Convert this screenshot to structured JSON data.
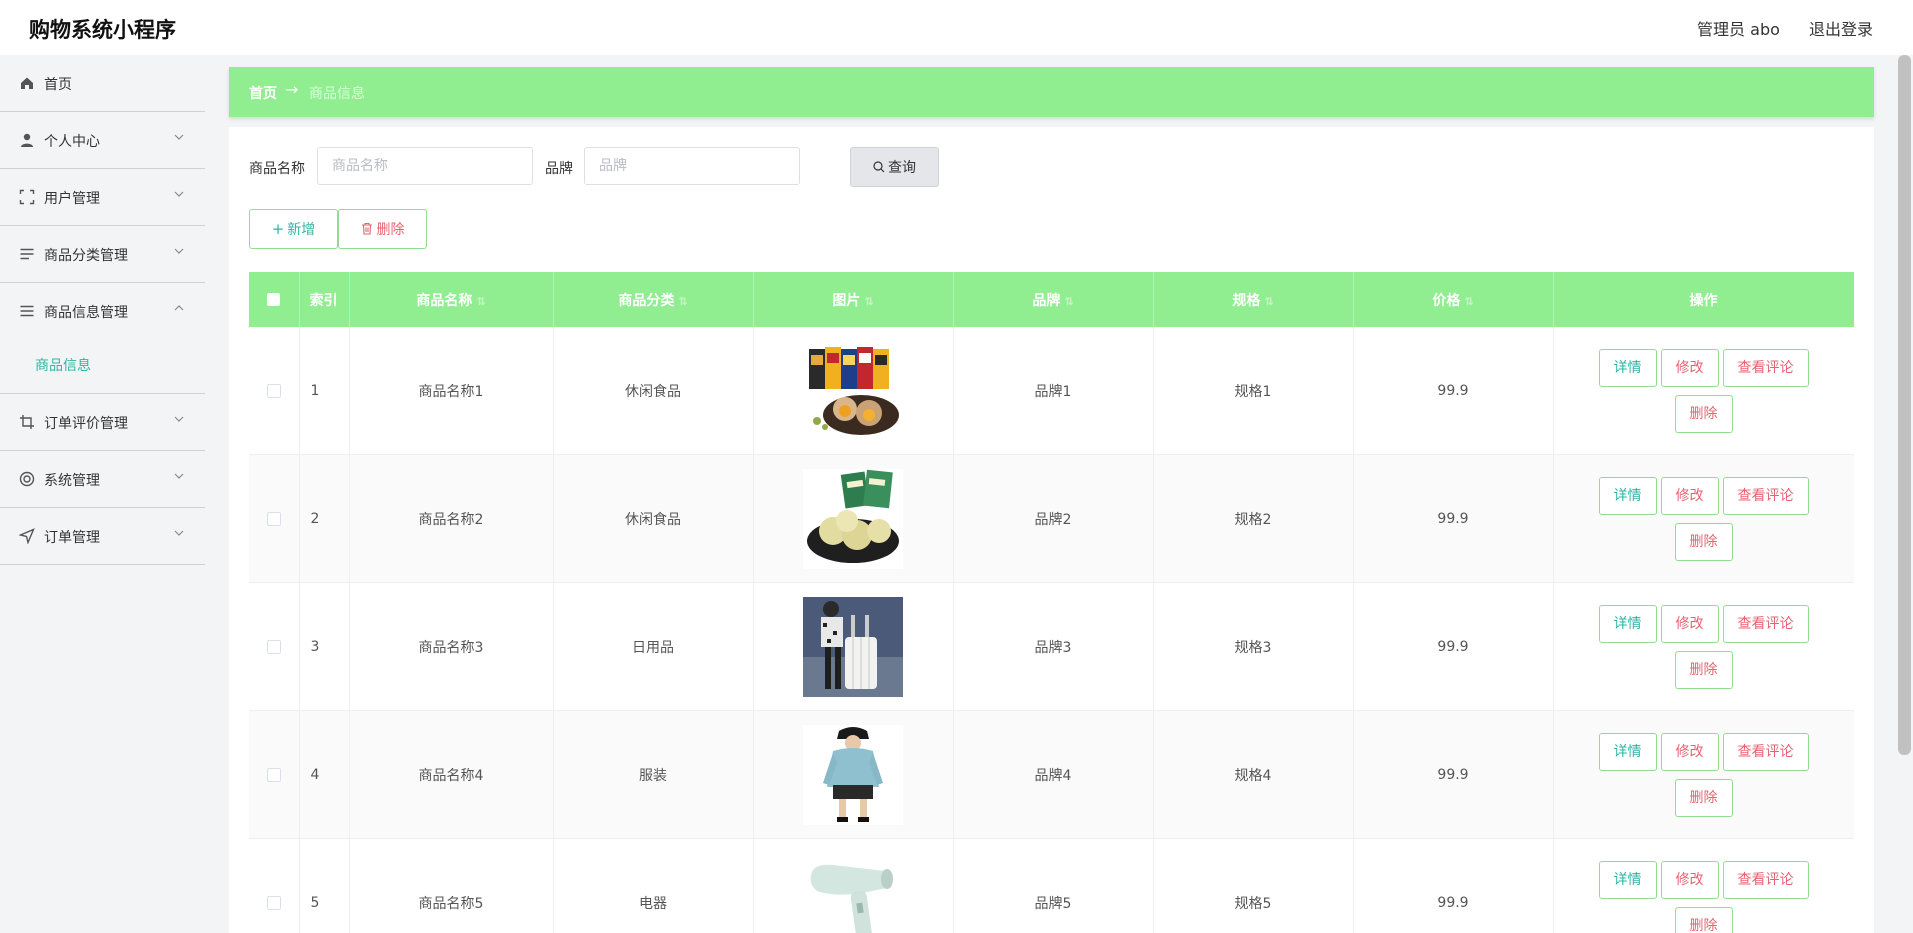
{
  "header": {
    "app_title": "购物系统小程序",
    "user_label": "管理员 abo",
    "logout_label": "退出登录"
  },
  "sidebar": {
    "items": [
      {
        "label": "首页",
        "icon": "home-icon",
        "has_chevron": false
      },
      {
        "label": "个人中心",
        "icon": "user-icon",
        "has_chevron": true
      },
      {
        "label": "用户管理",
        "icon": "frame-icon",
        "has_chevron": true
      },
      {
        "label": "商品分类管理",
        "icon": "list-icon",
        "has_chevron": true
      },
      {
        "label": "商品信息管理",
        "icon": "list-icon",
        "has_chevron": true,
        "expanded": true,
        "subitems": [
          {
            "label": "商品信息",
            "active": true
          }
        ]
      },
      {
        "label": "订单评价管理",
        "icon": "crop-icon",
        "has_chevron": true
      },
      {
        "label": "系统管理",
        "icon": "lifebuoy-icon",
        "has_chevron": true
      },
      {
        "label": "订单管理",
        "icon": "send-icon",
        "has_chevron": true
      }
    ]
  },
  "breadcrumb": {
    "home": "首页",
    "arrow": "→",
    "current": "商品信息"
  },
  "search": {
    "name_label": "商品名称",
    "name_value": "",
    "name_placeholder": "商品名称",
    "brand_label": "品牌",
    "brand_value": "",
    "brand_placeholder": "品牌",
    "query_label": "查询"
  },
  "actions": {
    "add_label": "新增",
    "delete_label": "删除"
  },
  "table": {
    "columns": [
      "索引",
      "商品名称",
      "商品分类",
      "图片",
      "品牌",
      "规格",
      "价格",
      "操作"
    ],
    "row_actions": {
      "detail": "详情",
      "edit": "修改",
      "review": "查看评论",
      "delete": "删除"
    },
    "rows": [
      {
        "index": "1",
        "name": "商品名称1",
        "category": "休闲食品",
        "image": "mooncake-box-photo",
        "brand": "品牌1",
        "spec": "规格1",
        "price": "99.9"
      },
      {
        "index": "2",
        "name": "商品名称2",
        "category": "休闲食品",
        "image": "green-pastry-photo",
        "brand": "品牌2",
        "spec": "规格2",
        "price": "99.9"
      },
      {
        "index": "3",
        "name": "商品名称3",
        "category": "日用品",
        "image": "luggage-photo",
        "brand": "品牌3",
        "spec": "规格3",
        "price": "99.9"
      },
      {
        "index": "4",
        "name": "商品名称4",
        "category": "服装",
        "image": "hoodie-photo",
        "brand": "品牌4",
        "spec": "规格4",
        "price": "99.9"
      },
      {
        "index": "5",
        "name": "商品名称5",
        "category": "电器",
        "image": "hairdryer-photo",
        "brand": "品牌5",
        "spec": "规格5",
        "price": "99.9"
      }
    ]
  },
  "colors": {
    "accent_green": "#90ee90",
    "teal_text": "#2fb5a3",
    "danger_text": "#e5636f"
  }
}
